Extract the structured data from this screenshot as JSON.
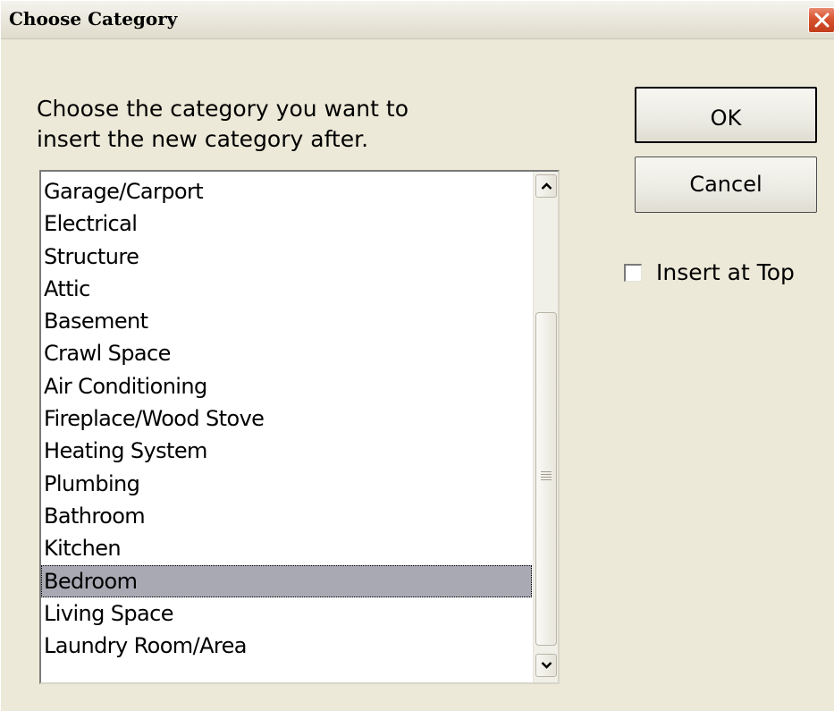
{
  "window": {
    "title": "Choose Category"
  },
  "prompt": {
    "line1": "Choose the category you want to",
    "line2": "insert the new category after."
  },
  "categories": {
    "items": [
      "Garage/Carport",
      "Electrical",
      "Structure",
      "Attic",
      "Basement",
      "Crawl Space",
      "Air Conditioning",
      "Fireplace/Wood Stove",
      "Heating System",
      "Plumbing",
      "Bathroom",
      "Kitchen",
      "Bedroom",
      "Living Space",
      "Laundry Room/Area"
    ],
    "selected": "Bedroom",
    "selected_index": 12
  },
  "buttons": {
    "ok_label": "OK",
    "cancel_label": "Cancel"
  },
  "insert_at_top": {
    "label": "Insert at Top",
    "checked": false
  },
  "icons": {
    "close": "close-icon",
    "scroll_up": "chevron-up-icon",
    "scroll_down": "chevron-down-icon"
  },
  "colors": {
    "dialog_background": "#ece9d8",
    "selection_background": "#a9a9b4",
    "close_button": "#d7532f"
  }
}
